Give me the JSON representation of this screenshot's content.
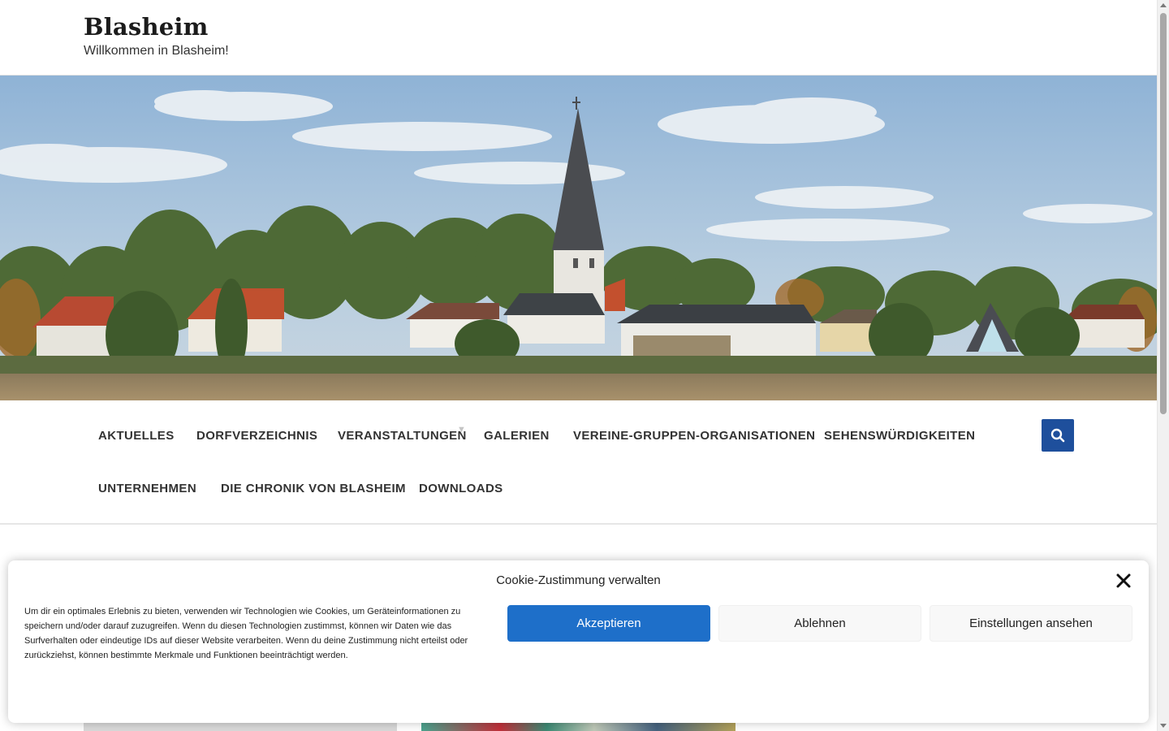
{
  "site": {
    "title": "Blasheim",
    "tagline": "Willkommen in Blasheim!"
  },
  "nav": {
    "items": [
      {
        "label": "AKTUELLES",
        "has_submenu": false
      },
      {
        "label": "DORFVERZEICHNIS",
        "has_submenu": false
      },
      {
        "label": "VERANSTALTUNGEN",
        "has_submenu": true
      },
      {
        "label": "GALERIEN",
        "has_submenu": false
      },
      {
        "label": "VEREINE-GRUPPEN-ORGANISATIONEN",
        "has_submenu": false
      },
      {
        "label": "SEHENSWÜRDIGKEITEN",
        "has_submenu": false
      },
      {
        "label": "UNTERNEHMEN",
        "has_submenu": false
      },
      {
        "label": "DIE CHRONIK VON BLASHEIM",
        "has_submenu": false
      },
      {
        "label": "DOWNLOADS",
        "has_submenu": false
      }
    ],
    "submenu_arrow": "▼",
    "search_icon": "search-icon"
  },
  "cookie": {
    "title": "Cookie-Zustimmung verwalten",
    "text": "Um dir ein optimales Erlebnis zu bieten, verwenden wir Technologien wie Cookies, um Geräteinformationen zu speichern und/oder darauf zuzugreifen. Wenn du diesen Technologien zustimmst, können wir Daten wie das Surfverhalten oder eindeutige IDs auf dieser Website verarbeiten. Wenn du deine Zustimmung nicht erteilst oder zurückziehst, können bestimmte Merkmale und Funktionen beeinträchtigt werden.",
    "accept_label": "Akzeptieren",
    "deny_label": "Ablehnen",
    "settings_label": "Einstellungen ansehen"
  },
  "colors": {
    "accent": "#1e4f9c",
    "accept_button": "#1e6fc9",
    "button_neutral": "#f8f8f8"
  }
}
